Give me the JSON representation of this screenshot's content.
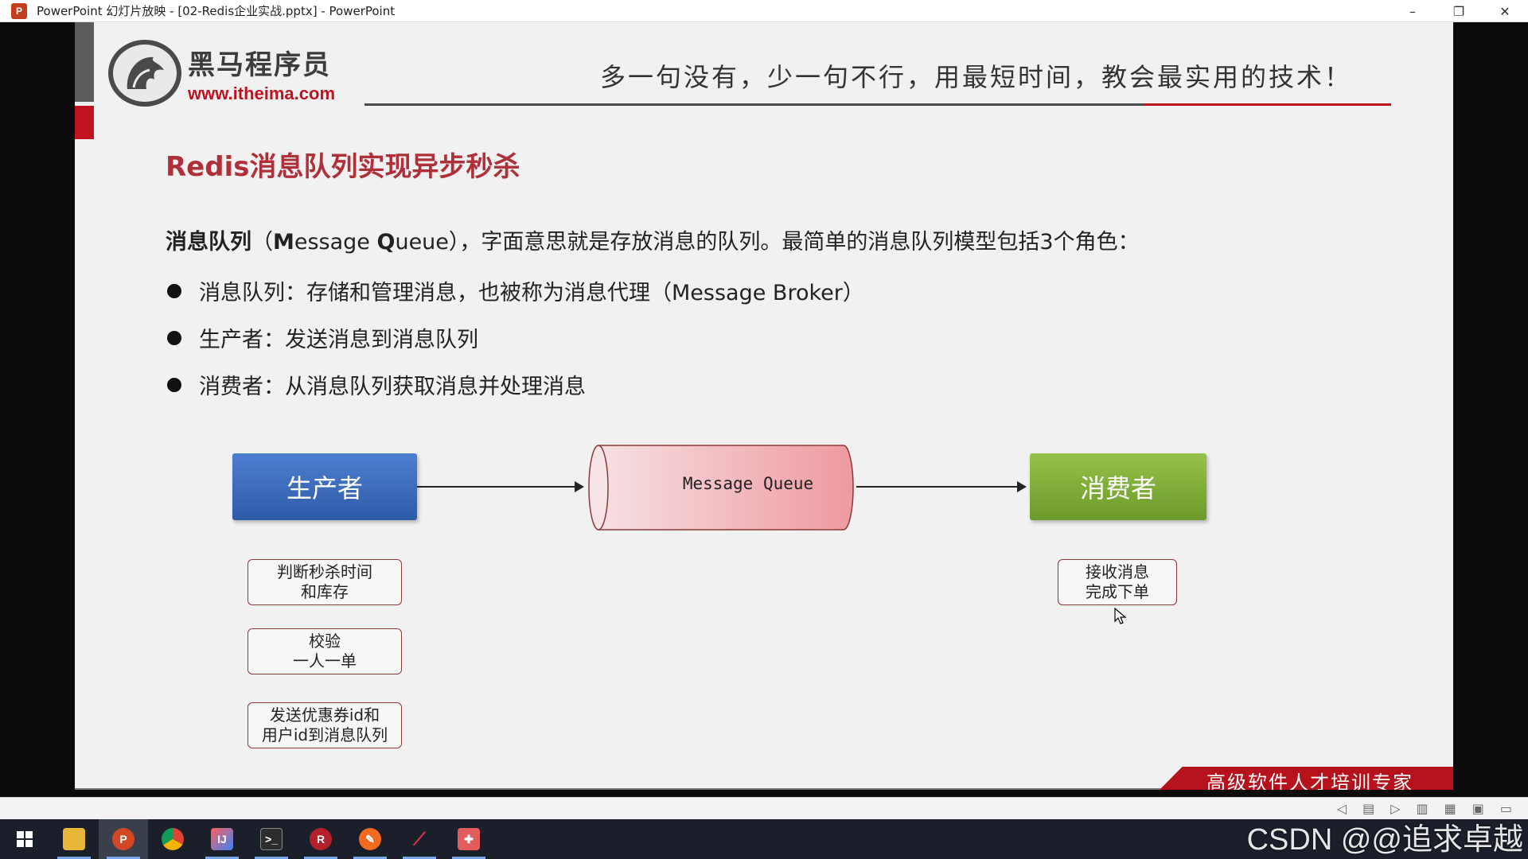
{
  "window": {
    "title": "PowerPoint 幻灯片放映 - [02-Redis企业实战.pptx] - PowerPoint",
    "minimize": "–",
    "restore": "❐",
    "close": "✕"
  },
  "slide": {
    "logo_cn": "黑马程序员",
    "logo_url": "www.itheima.com",
    "slogan": "多一句没有，少一句不行，用最短时间，教会最实用的技术！",
    "title": "Redis消息队列实现异步秒杀",
    "intro_bold_1": "消息队列",
    "intro_paren_open": "（",
    "intro_M": "M",
    "intro_essage": "essage ",
    "intro_Q": "Q",
    "intro_ueue": "ueue",
    "intro_rest": "），字面意思就是存放消息的队列。最简单的消息队列模型包括3个角色：",
    "bullets": [
      "消息队列：存储和管理消息，也被称为消息代理（Message Broker）",
      "生产者：发送消息到消息队列",
      "消费者：从消息队列获取消息并处理消息"
    ],
    "diagram": {
      "producer": "生产者",
      "queue": "Message Queue",
      "consumer": "消费者",
      "producer_notes": [
        {
          "line1": "判断秒杀时间",
          "line2": "和库存"
        },
        {
          "line1": "校验",
          "line2": "一人一单"
        },
        {
          "line1": "发送优惠券id和",
          "line2": "用户id到消息队列"
        }
      ],
      "consumer_note": {
        "line1": "接收消息",
        "line2": "完成下单"
      }
    },
    "ribbon": "高级软件人才培训专家",
    "colors": {
      "title_red": "#b0303a",
      "brand_red": "#c0121f",
      "producer_blue": "#2e5ba8",
      "consumer_green": "#6c9a2a",
      "queue_pink": "#f0a8ad"
    }
  },
  "watermark": "CSDN @@追求卓越",
  "taskbar": {
    "items": [
      "windows-start-icon",
      "file-explorer-icon",
      "powerpoint-icon",
      "chrome-icon",
      "intellij-icon",
      "terminal-icon",
      "redis-client-icon",
      "orange-app-icon",
      "pen-tool-icon",
      "annotation-tool-icon"
    ]
  }
}
